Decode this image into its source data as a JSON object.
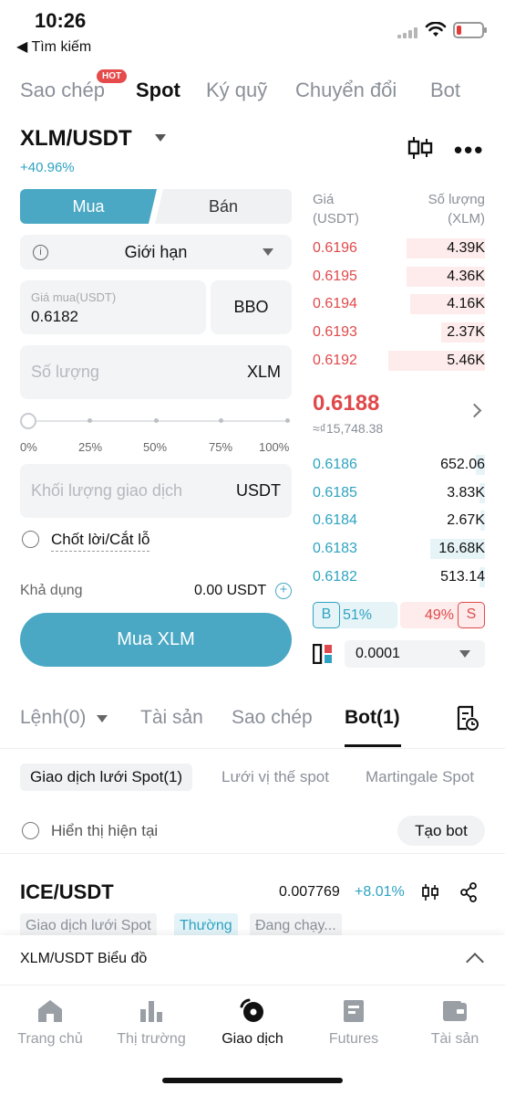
{
  "status_bar": {
    "time": "10:26",
    "back_label": "◀ Tìm kiếm"
  },
  "top_tabs": [
    {
      "label": "Sao chép",
      "badge": "HOT"
    },
    {
      "label": "Spot",
      "active": true
    },
    {
      "label": "Ký quỹ"
    },
    {
      "label": "Chuyển đổi"
    },
    {
      "label": "Bot"
    }
  ],
  "pair": {
    "symbol": "XLM/USDT",
    "change": "+40.96%"
  },
  "trade_form": {
    "buy_label": "Mua",
    "sell_label": "Bán",
    "order_type": "Giới hạn",
    "price_placeholder": "Giá mua(USDT)",
    "price_value": "0.6182",
    "bbo_label": "BBO",
    "qty_placeholder": "Số lượng",
    "qty_unit": "XLM",
    "slider_marks": [
      "0%",
      "25%",
      "50%",
      "75%",
      "100%"
    ],
    "slider_percent": 0,
    "volume_placeholder": "Khối lượng giao dịch",
    "volume_unit": "USDT",
    "tpsl_label": "Chốt lời/Cắt lỗ",
    "available_label": "Khả dụng",
    "available_value": "0.00 USDT",
    "submit_label": "Mua XLM"
  },
  "order_book": {
    "price_header": "Giá\n(USDT)",
    "qty_header": "Số lượng\n(XLM)",
    "asks": [
      {
        "price": "0.6196",
        "qty": "4.39K",
        "depth": 0.68
      },
      {
        "price": "0.6195",
        "qty": "4.36K",
        "depth": 0.68
      },
      {
        "price": "0.6194",
        "qty": "4.16K",
        "depth": 0.65
      },
      {
        "price": "0.6193",
        "qty": "2.37K",
        "depth": 0.38
      },
      {
        "price": "0.6192",
        "qty": "5.46K",
        "depth": 0.84
      }
    ],
    "last_price": "0.6188",
    "last_price_fiat": "≈₫15,748.38",
    "bids": [
      {
        "price": "0.6186",
        "qty": "652.06",
        "depth": 0.08
      },
      {
        "price": "0.6185",
        "qty": "3.83K",
        "depth": 0.05
      },
      {
        "price": "0.6184",
        "qty": "2.67K",
        "depth": 0.04
      },
      {
        "price": "0.6183",
        "qty": "16.68K",
        "depth": 0.48
      },
      {
        "price": "0.6182",
        "qty": "513.14",
        "depth": 0.05
      }
    ],
    "buy_ratio_label": "B",
    "buy_ratio": "51%",
    "sell_ratio": "49%",
    "sell_ratio_label": "S",
    "precision": "0.0001"
  },
  "order_tabs": [
    {
      "label": "Lệnh(0)"
    },
    {
      "label": "Tài sản"
    },
    {
      "label": "Sao chép"
    },
    {
      "label": "Bot(1)",
      "active": true
    }
  ],
  "bot_chips": [
    {
      "label": "Giao dịch lưới Spot(1)",
      "active": true
    },
    {
      "label": "Lưới vị thế spot"
    },
    {
      "label": "Martingale Spot"
    }
  ],
  "show_current_label": "Hiển thị hiện tại",
  "create_bot_label": "Tạo bot",
  "bot_item": {
    "pair": "ICE/USDT",
    "price": "0.007769",
    "change": "+8.01%",
    "tags": [
      "Giao dịch lưới Spot",
      "Thường",
      "Đang chạy..."
    ]
  },
  "chart_bar": {
    "label": "XLM/USDT  Biểu đồ"
  },
  "bottom_nav": [
    {
      "label": "Trang chủ",
      "icon": "home-icon"
    },
    {
      "label": "Thị trường",
      "icon": "market-icon"
    },
    {
      "label": "Giao dịch",
      "icon": "trade-icon",
      "active": true
    },
    {
      "label": "Futures",
      "icon": "futures-icon"
    },
    {
      "label": "Tài sản",
      "icon": "wallet-icon"
    }
  ],
  "colors": {
    "accent": "#4aa8c4",
    "ask": "#e0494b",
    "bid": "#2ea3c1"
  }
}
